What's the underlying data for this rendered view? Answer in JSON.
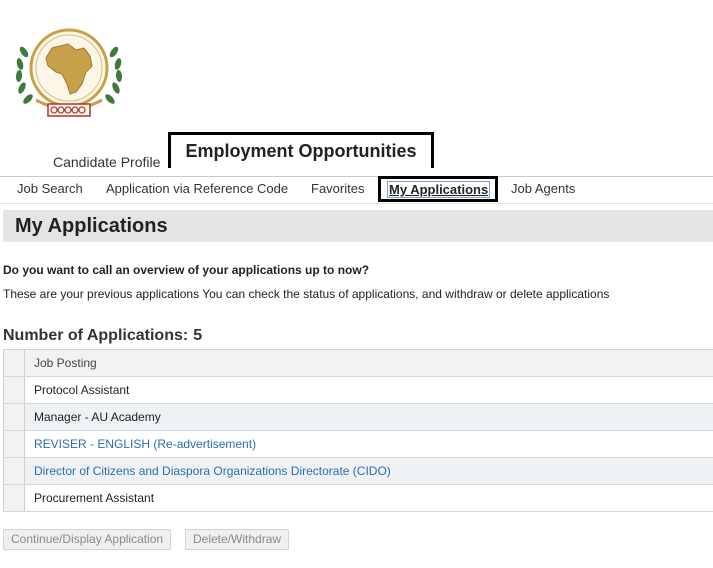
{
  "header": {
    "tabs": [
      {
        "label": "Candidate Profile",
        "active": false
      },
      {
        "label": "Employment Opportunities",
        "active": true
      }
    ]
  },
  "subnav": {
    "items": [
      {
        "label": "Job Search",
        "active": false
      },
      {
        "label": "Application via Reference Code",
        "active": false
      },
      {
        "label": "Favorites",
        "active": false
      },
      {
        "label": "My Applications",
        "active": true
      },
      {
        "label": "Job Agents",
        "active": false
      }
    ]
  },
  "page": {
    "title": "My Applications",
    "question": "Do you want to call an overview of your applications up to now?",
    "description": "These are your previous applications You can check the status of applications, and withdraw or delete applications"
  },
  "applications": {
    "count_label": "Number of Applications:",
    "count": "5",
    "column_header": "Job Posting",
    "rows": [
      {
        "title": "Protocol Assistant",
        "is_link": false
      },
      {
        "title": "Manager - AU Academy",
        "is_link": false
      },
      {
        "title": "REVISER - ENGLISH (Re-advertisement)",
        "is_link": true
      },
      {
        "title": "Director of Citizens and Diaspora Organizations Directorate (CIDO)",
        "is_link": true
      },
      {
        "title": "Procurement Assistant",
        "is_link": false
      }
    ]
  },
  "buttons": {
    "continue_label": "Continue/Display Application",
    "delete_label": "Delete/Withdraw"
  },
  "colors": {
    "link": "#2a6eac",
    "header_bg": "#e4e4e4",
    "row_alt": "#eef2f5",
    "logo_gold": "#c8a04a",
    "logo_green": "#3f7a3a",
    "logo_red": "#b3322e"
  },
  "icons": {
    "logo": "african-union-emblem"
  }
}
